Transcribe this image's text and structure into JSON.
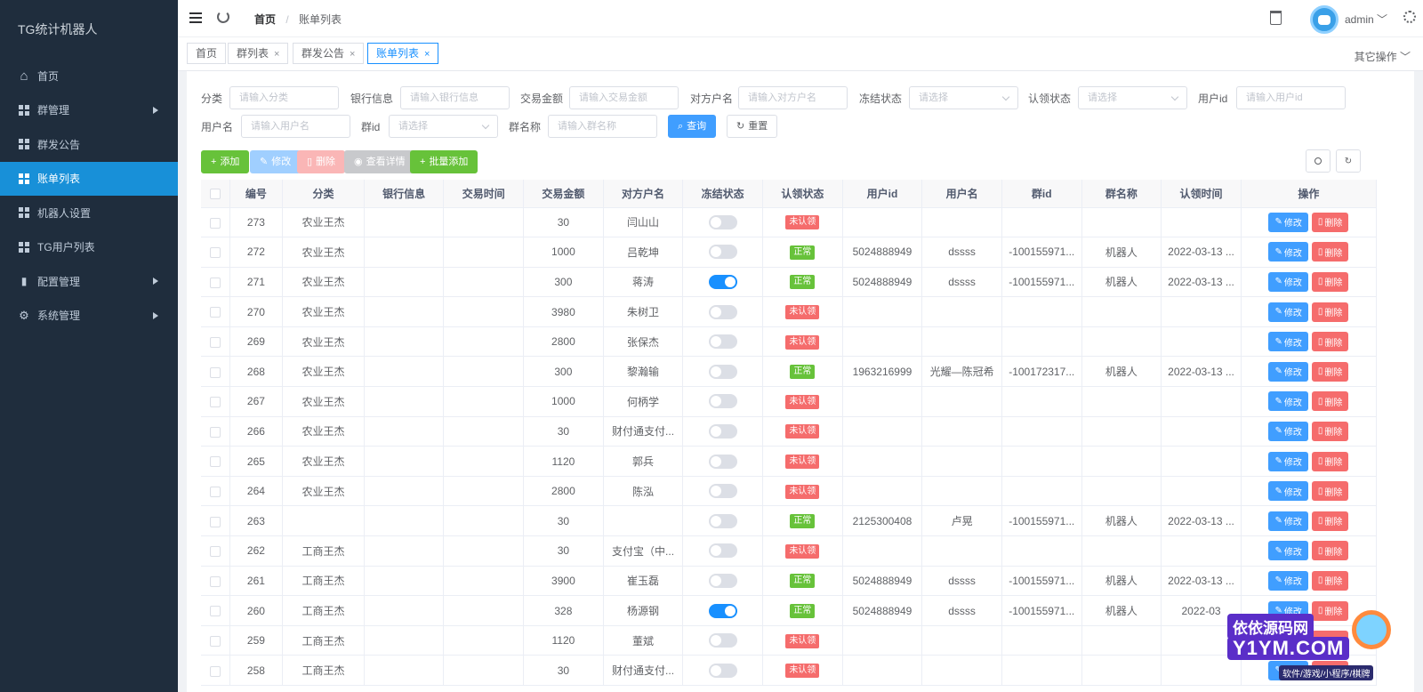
{
  "app": {
    "title": "TG统计机器人"
  },
  "sidebar": {
    "items": [
      {
        "label": "首页",
        "icon": "home-icon",
        "active": false,
        "submenu": false
      },
      {
        "label": "群管理",
        "icon": "grid-icon",
        "active": false,
        "submenu": true
      },
      {
        "label": "群发公告",
        "icon": "grid-icon",
        "active": false,
        "submenu": false
      },
      {
        "label": "账单列表",
        "icon": "grid-icon",
        "active": true,
        "submenu": false
      },
      {
        "label": "机器人设置",
        "icon": "grid-icon",
        "active": false,
        "submenu": false
      },
      {
        "label": "TG用户列表",
        "icon": "grid-icon",
        "active": false,
        "submenu": false
      },
      {
        "label": "配置管理",
        "icon": "bar-chart-icon",
        "active": false,
        "submenu": true
      },
      {
        "label": "系统管理",
        "icon": "gear-icon",
        "active": false,
        "submenu": true
      }
    ]
  },
  "header": {
    "breadcrumb": {
      "home": "首页",
      "current": "账单列表"
    },
    "user": "admin"
  },
  "tags": {
    "items": [
      {
        "label": "首页",
        "closable": false,
        "active": false
      },
      {
        "label": "群列表",
        "closable": true,
        "active": false
      },
      {
        "label": "群发公告",
        "closable": true,
        "active": false
      },
      {
        "label": "账单列表",
        "closable": true,
        "active": true
      }
    ],
    "close": "×",
    "other_ops": "其它操作"
  },
  "filters": {
    "category": {
      "label": "分类",
      "placeholder": "请输入分类"
    },
    "bank": {
      "label": "银行信息",
      "placeholder": "请输入银行信息"
    },
    "amount": {
      "label": "交易金额",
      "placeholder": "请输入交易金额"
    },
    "counterparty": {
      "label": "对方户名",
      "placeholder": "请输入对方户名"
    },
    "freeze": {
      "label": "冻结状态",
      "placeholder": "请选择"
    },
    "claim": {
      "label": "认领状态",
      "placeholder": "请选择"
    },
    "userid": {
      "label": "用户id",
      "placeholder": "请输入用户id"
    },
    "username": {
      "label": "用户名",
      "placeholder": "请输入用户名"
    },
    "groupid": {
      "label": "群id",
      "placeholder": "请选择"
    },
    "groupname": {
      "label": "群名称",
      "placeholder": "请输入群名称"
    },
    "search_btn": "查询",
    "reset_btn": "重置"
  },
  "toolbar": {
    "add": "添加",
    "edit": "修改",
    "delete": "删除",
    "view": "查看详情",
    "batch_add": "批量添加"
  },
  "table": {
    "columns": [
      "编号",
      "分类",
      "银行信息",
      "交易时间",
      "交易金额",
      "对方户名",
      "冻结状态",
      "认领状态",
      "用户id",
      "用户名",
      "群id",
      "群名称",
      "认领时间",
      "操作"
    ],
    "edit_label": "修改",
    "delete_label": "删除",
    "rows": [
      {
        "id": "273",
        "category": "农业王杰",
        "bank": "",
        "time": "",
        "amount": "30",
        "counterparty": "闫山山",
        "frozen": false,
        "status": "未认领",
        "claimed": false,
        "userid": "",
        "username": "",
        "groupid": "",
        "groupname": "",
        "claim_time": ""
      },
      {
        "id": "272",
        "category": "农业王杰",
        "bank": "",
        "time": "",
        "amount": "1000",
        "counterparty": "吕乾坤",
        "frozen": false,
        "status": "正常",
        "claimed": true,
        "userid": "5024888949",
        "username": "dssss",
        "groupid": "-100155971...",
        "groupname": "机器人",
        "claim_time": "2022-03-13 ..."
      },
      {
        "id": "271",
        "category": "农业王杰",
        "bank": "",
        "time": "",
        "amount": "300",
        "counterparty": "蒋涛",
        "frozen": true,
        "status": "正常",
        "claimed": true,
        "userid": "5024888949",
        "username": "dssss",
        "groupid": "-100155971...",
        "groupname": "机器人",
        "claim_time": "2022-03-13 ..."
      },
      {
        "id": "270",
        "category": "农业王杰",
        "bank": "",
        "time": "",
        "amount": "3980",
        "counterparty": "朱树卫",
        "frozen": false,
        "status": "未认领",
        "claimed": false,
        "userid": "",
        "username": "",
        "groupid": "",
        "groupname": "",
        "claim_time": ""
      },
      {
        "id": "269",
        "category": "农业王杰",
        "bank": "",
        "time": "",
        "amount": "2800",
        "counterparty": "张保杰",
        "frozen": false,
        "status": "未认领",
        "claimed": false,
        "userid": "",
        "username": "",
        "groupid": "",
        "groupname": "",
        "claim_time": ""
      },
      {
        "id": "268",
        "category": "农业王杰",
        "bank": "",
        "time": "",
        "amount": "300",
        "counterparty": "黎瀚输",
        "frozen": false,
        "status": "正常",
        "claimed": true,
        "userid": "1963216999",
        "username": "光耀—陈冠希",
        "groupid": "-100172317...",
        "groupname": "机器人",
        "claim_time": "2022-03-13 ..."
      },
      {
        "id": "267",
        "category": "农业王杰",
        "bank": "",
        "time": "",
        "amount": "1000",
        "counterparty": "何柄学",
        "frozen": false,
        "status": "未认领",
        "claimed": false,
        "userid": "",
        "username": "",
        "groupid": "",
        "groupname": "",
        "claim_time": ""
      },
      {
        "id": "266",
        "category": "农业王杰",
        "bank": "",
        "time": "",
        "amount": "30",
        "counterparty": "财付通支付...",
        "frozen": false,
        "status": "未认领",
        "claimed": false,
        "userid": "",
        "username": "",
        "groupid": "",
        "groupname": "",
        "claim_time": ""
      },
      {
        "id": "265",
        "category": "农业王杰",
        "bank": "",
        "time": "",
        "amount": "1120",
        "counterparty": "郭兵",
        "frozen": false,
        "status": "未认领",
        "claimed": false,
        "userid": "",
        "username": "",
        "groupid": "",
        "groupname": "",
        "claim_time": ""
      },
      {
        "id": "264",
        "category": "农业王杰",
        "bank": "",
        "time": "",
        "amount": "2800",
        "counterparty": "陈泓",
        "frozen": false,
        "status": "未认领",
        "claimed": false,
        "userid": "",
        "username": "",
        "groupid": "",
        "groupname": "",
        "claim_time": ""
      },
      {
        "id": "263",
        "category": "",
        "bank": "",
        "time": "",
        "amount": "30",
        "counterparty": "",
        "frozen": false,
        "status": "正常",
        "claimed": true,
        "userid": "2125300408",
        "username": "卢晃",
        "groupid": "-100155971...",
        "groupname": "机器人",
        "claim_time": "2022-03-13 ..."
      },
      {
        "id": "262",
        "category": "工商王杰",
        "bank": "",
        "time": "",
        "amount": "30",
        "counterparty": "支付宝（中...",
        "frozen": false,
        "status": "未认领",
        "claimed": false,
        "userid": "",
        "username": "",
        "groupid": "",
        "groupname": "",
        "claim_time": ""
      },
      {
        "id": "261",
        "category": "工商王杰",
        "bank": "",
        "time": "",
        "amount": "3900",
        "counterparty": "崔玉磊",
        "frozen": false,
        "status": "正常",
        "claimed": true,
        "userid": "5024888949",
        "username": "dssss",
        "groupid": "-100155971...",
        "groupname": "机器人",
        "claim_time": "2022-03-13 ..."
      },
      {
        "id": "260",
        "category": "工商王杰",
        "bank": "",
        "time": "",
        "amount": "328",
        "counterparty": "杨源钢",
        "frozen": true,
        "status": "正常",
        "claimed": true,
        "userid": "5024888949",
        "username": "dssss",
        "groupid": "-100155971...",
        "groupname": "机器人",
        "claim_time": "2022-03"
      },
      {
        "id": "259",
        "category": "工商王杰",
        "bank": "",
        "time": "",
        "amount": "1120",
        "counterparty": "董斌",
        "frozen": false,
        "status": "未认领",
        "claimed": false,
        "userid": "",
        "username": "",
        "groupid": "",
        "groupname": "",
        "claim_time": ""
      },
      {
        "id": "258",
        "category": "工商王杰",
        "bank": "",
        "time": "",
        "amount": "30",
        "counterparty": "财付通支付...",
        "frozen": false,
        "status": "未认领",
        "claimed": false,
        "userid": "",
        "username": "",
        "groupid": "",
        "groupname": "",
        "claim_time": ""
      }
    ]
  },
  "watermark": {
    "line1": "依依源码网",
    "line2": "Y1YM.COM",
    "line3": "软件/游戏/小程序/棋牌"
  },
  "colors": {
    "sidebar_bg": "#1f2d3d",
    "active_menu": "#1890d8",
    "primary": "#409eff",
    "success": "#67c23a",
    "danger": "#f56c6c"
  }
}
